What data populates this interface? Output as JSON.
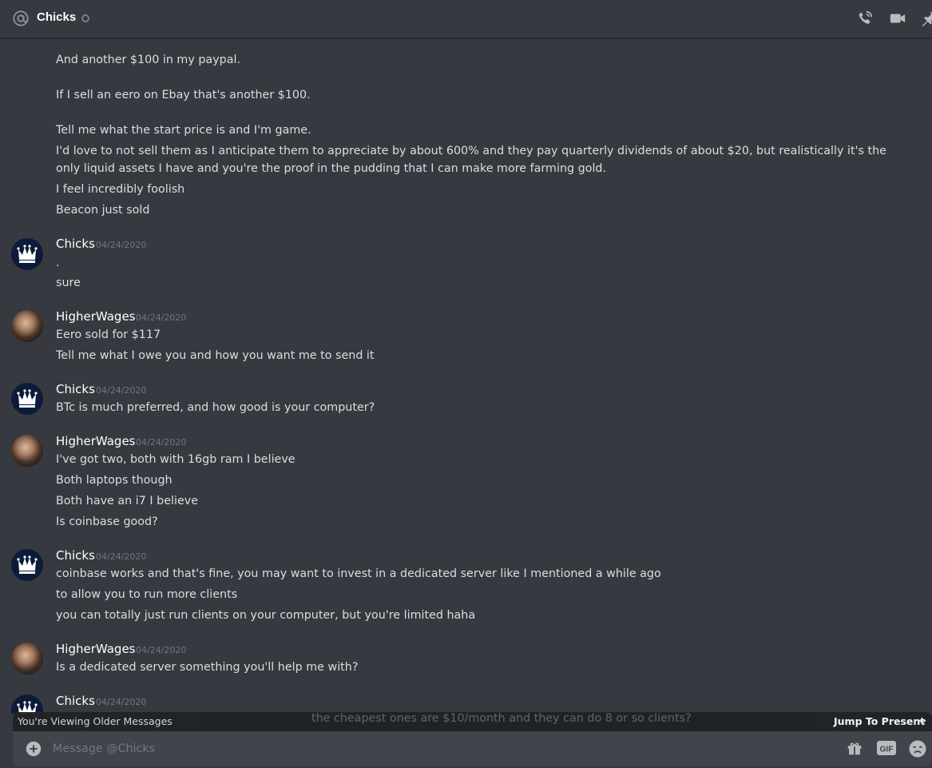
{
  "header": {
    "title": "Chicks",
    "icons": [
      "at-icon",
      "status-dot",
      "phone-call-icon",
      "video-camera-icon",
      "pin-icon"
    ]
  },
  "messages": {
    "continuation_lines": [
      "And another $100 in my paypal.",
      "If I sell an eero on Ebay that's another $100.",
      "Tell me what the start price is and I'm game.",
      "I'd love to not sell them as I anticipate them to appreciate by about 600% and they pay quarterly dividends of about $20, but realistically it's the only liquid assets I have and you're the proof in the pudding that I can make more farming gold.",
      "I feel incredibly foolish",
      "Beacon just sold"
    ],
    "groups": [
      {
        "author": "Chicks",
        "timestamp": "04/24/2020",
        "lines": [
          ".",
          "sure"
        ]
      },
      {
        "author": "HigherWages",
        "timestamp": "04/24/2020",
        "lines": [
          "Eero sold for $117",
          "Tell me what I owe you and how you want me to send it"
        ]
      },
      {
        "author": "Chicks",
        "timestamp": "04/24/2020",
        "lines": [
          "BTc is much preferred, and how good is your computer?"
        ]
      },
      {
        "author": "HigherWages",
        "timestamp": "04/24/2020",
        "lines": [
          "I've got two, both with 16gb ram I believe",
          "Both laptops though",
          "Both have an i7 I believe",
          "Is coinbase good?"
        ]
      },
      {
        "author": "Chicks",
        "timestamp": "04/24/2020",
        "lines": [
          "coinbase works and that's fine, you may want to invest in a dedicated server like I mentioned a while ago",
          "to allow you to run more clients",
          "you can totally just run clients on your computer, but you're limited haha"
        ]
      },
      {
        "author": "HigherWages",
        "timestamp": "04/24/2020",
        "lines": [
          "Is a dedicated server something you'll help me with?"
        ]
      },
      {
        "author": "Chicks",
        "timestamp": "04/24/2020",
        "lines": [
          "the cheapest ones are $10/month and they can do 8 or so clients?"
        ]
      }
    ]
  },
  "older_bar": {
    "notice": "You're Viewing Older Messages",
    "jump_label": "Jump To Present"
  },
  "composer": {
    "placeholder": "Message @Chicks",
    "icons": [
      "plus-circle-icon",
      "gift-icon",
      "gif-icon",
      "emoji-icon"
    ]
  },
  "colors": {
    "background": "#36393f",
    "composer": "#40444b",
    "bar": "#202225",
    "timestamp": "#72767d"
  }
}
